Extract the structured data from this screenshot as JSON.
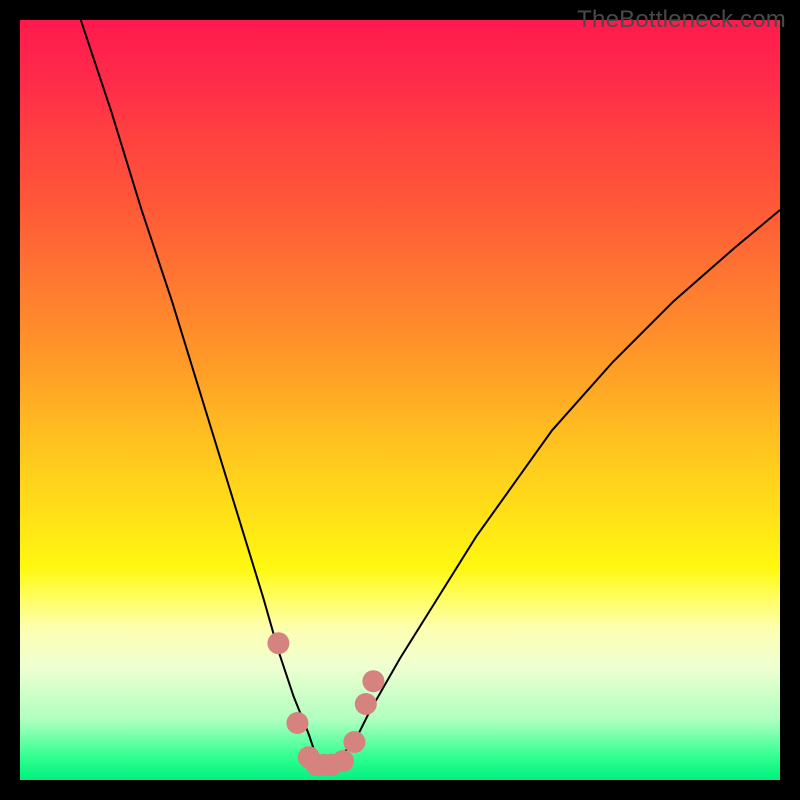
{
  "watermark": "TheBottleneck.com",
  "chart_data": {
    "type": "line",
    "title": "",
    "xlabel": "",
    "ylabel": "",
    "xlim": [
      0,
      100
    ],
    "ylim": [
      0,
      100
    ],
    "series": [
      {
        "name": "bottleneck-curve",
        "x": [
          8,
          12,
          16,
          20,
          24,
          28,
          32,
          34,
          36,
          38,
          39,
          40,
          41,
          42,
          44,
          46,
          50,
          55,
          60,
          65,
          70,
          78,
          86,
          94,
          100
        ],
        "values": [
          100,
          88,
          75,
          63,
          50,
          37,
          24,
          17,
          11,
          6,
          3,
          2,
          2,
          3,
          5,
          9,
          16,
          24,
          32,
          39,
          46,
          55,
          63,
          70,
          75
        ]
      }
    ],
    "markers": {
      "name": "highlight-dots",
      "color": "#d6827f",
      "x": [
        34.0,
        36.5,
        38.0,
        39.0,
        40.0,
        41.0,
        42.5,
        44.0,
        45.5,
        46.5
      ],
      "values": [
        18.0,
        7.5,
        3.0,
        2.0,
        2.0,
        2.0,
        2.5,
        5.0,
        10.0,
        13.0
      ]
    }
  }
}
